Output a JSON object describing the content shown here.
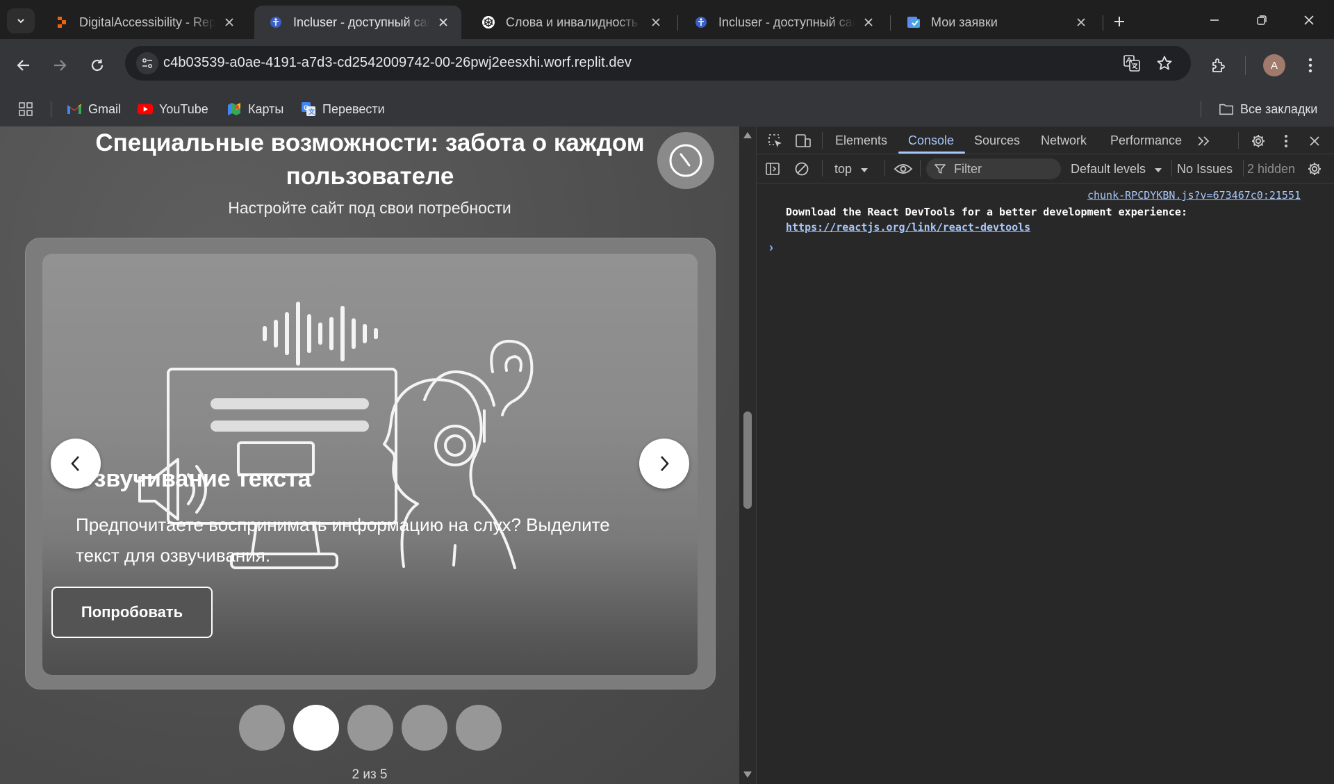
{
  "browser": {
    "tabs": [
      {
        "title": "DigitalAccessibility - Repl",
        "favicon": "replit-icon"
      },
      {
        "title": "Incluser - доступный сай",
        "favicon": "incluser-icon",
        "active": true
      },
      {
        "title": "Слова и инвалидность",
        "favicon": "chatgpt-icon"
      },
      {
        "title": "Incluser - доступный сай",
        "favicon": "incluser-icon"
      },
      {
        "title": "Мои заявки",
        "favicon": "tasks-icon"
      }
    ],
    "url": "c4b03539-a0ae-4191-a7d3-cd2542009742-00-26pwj2eesxhi.worf.replit.dev",
    "profile_initial": "A",
    "bookmarks": [
      {
        "label": "Gmail",
        "icon": "gmail-icon"
      },
      {
        "label": "YouTube",
        "icon": "youtube-icon"
      },
      {
        "label": "Карты",
        "icon": "maps-icon"
      },
      {
        "label": "Перевести",
        "icon": "translate-icon"
      }
    ],
    "all_bookmarks_label": "Все закладки"
  },
  "page": {
    "title_line1": "Специальные возможности: забота о каждом",
    "title_line2": "пользователе",
    "subtitle": "Настройте сайт под свои потребности",
    "slide": {
      "heading": "Озвучивание текста",
      "text": "Предпочитаете воспринимать информацию на слух? Выделите текст для озвучивания.",
      "button_label": "Попробовать"
    },
    "dots_total": 5,
    "active_dot": 2,
    "counter": "2 из 5"
  },
  "devtools": {
    "tabs": [
      "Elements",
      "Console",
      "Sources",
      "Network",
      "Performance"
    ],
    "active_tab": "Console",
    "context": "top",
    "filter_placeholder": "Filter",
    "levels": "Default levels",
    "issues": "No Issues",
    "hidden": "2 hidden",
    "console": {
      "source": "chunk-RPCDYKBN.js?v=673467c0:21551",
      "message": "Download the React DevTools for a better development experience:",
      "link": "https://reactjs.org/link/react-devtools"
    }
  },
  "colors": {
    "accent_blue": "#a8c7fa",
    "tab_active_bg": "#35363a",
    "devtools_bg": "#282828"
  }
}
